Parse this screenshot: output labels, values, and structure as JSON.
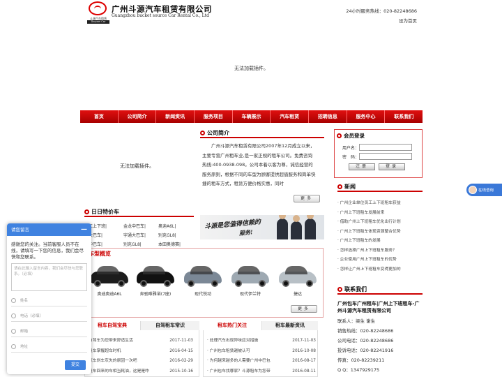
{
  "header": {
    "logo_small": "斗源汽车租赁",
    "logo_small2": "Doyuan Car Rental",
    "title_cn": "广州斗源汽车租赁有限公司",
    "title_en": "Guangzhou bucket source Car Rental Co., Ltd",
    "hotline": "24小时服务热线：020-82248686",
    "set_home": "设为首页"
  },
  "flash_notice": "无法加载插件。",
  "nav": [
    "首页",
    "公司简介",
    "新闻资讯",
    "服务项目",
    "车辆展示",
    "汽车租赁",
    "招聘信息",
    "服务中心",
    "联系我们"
  ],
  "left": {
    "flash_notice": "无法加载插件。",
    "special_title": "日日特价车",
    "special_rows": [
      [
        "工上下班|",
        "金龙中巴车|",
        "奥迪A6L|"
      ],
      [
        "大巴车|",
        "宇通大巴车|",
        "别克GL8|"
      ],
      [
        "中巴车|",
        "别克GL8|",
        "本田奥德赛|"
      ]
    ]
  },
  "intro": {
    "title": "公司简介",
    "text": "广州斗源汽车租赁有限公司2007年12月成立以来，主要专营广州租车业,是一家正规的租车公司。免费咨询热线:400-0938-098。公司本着以客为尊，诚信经营的服务原则，根据不同的车型为顾客提供超值服务和简单快捷的租车方式，租赁方便价格实惠，同时",
    "more": "更多"
  },
  "banner": {
    "line1": "斗源是您值得信赖的",
    "line2": "服务!"
  },
  "models": {
    "title": "车型概览",
    "cars": [
      {
        "label": "奥迪奥迪A6L",
        "color": "#1c1c1c"
      },
      {
        "label": "奔驰唯雅诺(7座)",
        "color": "#111111"
      },
      {
        "label": "现代悦动",
        "color": "#7b8896"
      },
      {
        "label": "现代伊兰特",
        "color": "#9ea9b2"
      },
      {
        "label": "捷达",
        "color": "#b8c0c6"
      }
    ],
    "more": "更多"
  },
  "tabs_left": {
    "active": "租车自驾宝典",
    "inactive": "自驾租车常识",
    "items": [
      {
        "text": "自驾车为您带来舒适生活",
        "date": "2017-11-03"
      },
      {
        "text": "租车掌握超车时机",
        "date": "2016-04-15"
      },
      {
        "text": "汽车刹车灰失的原因一次吧",
        "date": "2016-02-29"
      },
      {
        "text": "租车回来的车相当耗油，这是是咋",
        "date": "2015-10-16"
      }
    ]
  },
  "tabs_mid": {
    "active": "租车热门关注",
    "inactive": "租车最新资讯",
    "items": [
      {
        "text": "· 处理汽车出现异味应对措施",
        "date": "2017-11-03"
      },
      {
        "text": "· 广州包车租赁越被认可",
        "date": "2016-10-08"
      },
      {
        "text": "· 为何越来越多的人需要广州中巴包",
        "date": "2016-08-17"
      },
      {
        "text": "· 广州包车找哪家？斗源租车为您带",
        "date": "2016-08-11"
      }
    ]
  },
  "login": {
    "title": "会员登录",
    "user_label": "用户名：",
    "pass_label": "密　码：",
    "register": "注册",
    "login": "登录"
  },
  "news": {
    "title": "新闻",
    "items": [
      "· 广州企业单位员工上下班租车获益",
      "· 广州上下班租车发展前来",
      "· 借助广州上下班租车优化出行计划",
      "· 广州上下班租车体现资源整合优势",
      "· 广州上下班租车的发展",
      "· 怎样选择广州上下班租车服务？",
      "· 企业使用广州上下班租车的优势",
      "· 怎样让广州上下班租车变得更加的"
    ]
  },
  "contact": {
    "title": "联系我们",
    "company": "广州包车广州租车|广州上下班租车-广州斗源汽车租赁有限公司",
    "lines": [
      "联系人：梁生 谢生",
      "销售热线：020-82248686",
      "公司电话：020-82248686",
      "投诉电话：020-82241916",
      "传真：020-82239211",
      "Q Q：1347929175"
    ]
  },
  "float_service": "在线咨询",
  "chat": {
    "title": "请您留言",
    "minimize": "—",
    "message": "感谢您的关注。当前客服人员不在线，请填写一下您的信息，我们会尽快和您联系。",
    "textarea_placeholder": "请在此输入留言内容，我们会尽快与您联系。（必填）",
    "fields": [
      "姓名",
      "电话（必填）",
      "邮箱",
      "地址"
    ],
    "submit": "提交"
  }
}
